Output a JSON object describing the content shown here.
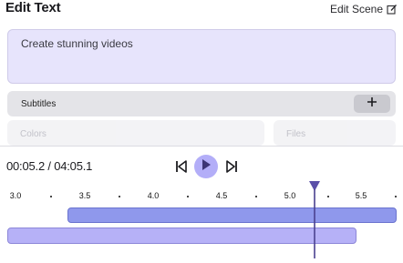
{
  "header": {
    "title": "Edit Text",
    "edit_scene_label": "Edit Scene",
    "edit_scene_icon": "edit-icon"
  },
  "editor": {
    "text_value": "Create stunning videos"
  },
  "subtitles": {
    "label": "Subtitles",
    "add_icon": "plus-icon"
  },
  "faded_tabs": [
    {
      "label": "Colors"
    },
    {
      "label": "Files"
    }
  ],
  "player": {
    "current_time": "00:05.2",
    "total_time": "04:05.1",
    "readout": "00:05.2 / 04:05.1",
    "prev_icon": "skip-previous-icon",
    "play_icon": "play-icon",
    "next_icon": "skip-next-icon"
  },
  "timeline": {
    "ticks": [
      "3.0",
      "3.5",
      "4.0",
      "4.5",
      "5.0",
      "5.5"
    ],
    "playhead_time": 5.2,
    "colors": {
      "accent": "#b3aef8",
      "clip_primary": "#8f98ec",
      "clip_secondary": "#b6b1f7",
      "playhead": "#5a4fa8"
    }
  }
}
